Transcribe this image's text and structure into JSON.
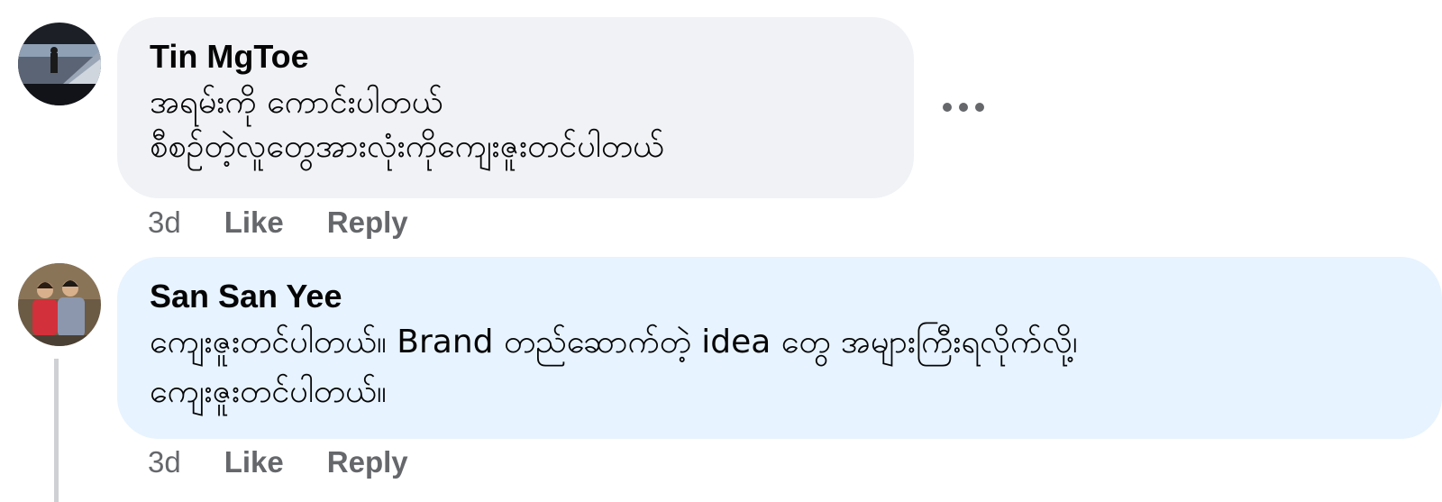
{
  "comments": [
    {
      "author": "Tin MgToe",
      "lines": [
        "အရမ်းကို ကောင်းပါတယ်",
        "စီစဉ်တဲ့လူတွေအားလုံးကိုကျေးဇူးတင်ပါတယ်"
      ],
      "time": "3d",
      "like_label": "Like",
      "reply_label": "Reply",
      "bubble_color": "#f0f2f5",
      "avatar_icon": "profile-photo"
    },
    {
      "author": "San San Yee",
      "lines": [
        "ကျေးဇူးတင်ပါတယ်။ Brand တည်ဆောက်တဲ့ idea တွေ အများကြီးရလိုက်လို့၊",
        "ကျေးဇူးတင်ပါတယ်။"
      ],
      "time": "3d",
      "like_label": "Like",
      "reply_label": "Reply",
      "bubble_color": "#e7f3ff",
      "avatar_icon": "profile-photo"
    }
  ],
  "more_icon": "more-horizontal-icon",
  "colors": {
    "meta_text": "#65676b",
    "thread_line": "#ced0d4"
  }
}
